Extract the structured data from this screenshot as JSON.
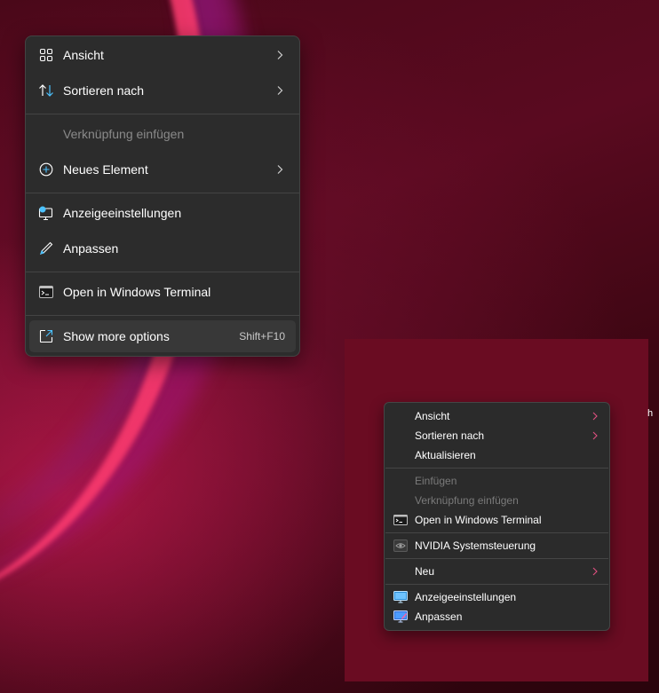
{
  "modern_menu": {
    "items": [
      {
        "label": "Ansicht",
        "icon": "view-grid-icon",
        "submenu": true
      },
      {
        "label": "Sortieren nach",
        "icon": "sort-icon",
        "submenu": true
      },
      {
        "label": "Verknüpfung einfügen",
        "disabled": true
      },
      {
        "label": "Neues Element",
        "icon": "new-item-icon",
        "submenu": true
      },
      {
        "label": "Anzeigeeinstellungen",
        "icon": "display-settings-icon"
      },
      {
        "label": "Anpassen",
        "icon": "personalize-pen-icon"
      },
      {
        "label": "Open in Windows Terminal",
        "icon": "terminal-icon"
      },
      {
        "label": "Show more options",
        "icon": "show-more-options-icon",
        "shortcut": "Shift+F10"
      }
    ]
  },
  "classic_menu": {
    "items": [
      {
        "label": "Ansicht",
        "submenu": true
      },
      {
        "label": "Sortieren nach",
        "submenu": true
      },
      {
        "label": "Aktualisieren"
      },
      {
        "label": "Einfügen",
        "disabled": true
      },
      {
        "label": "Verknüpfung einfügen",
        "disabled": true
      },
      {
        "label": "Open in Windows Terminal",
        "icon": "terminal-icon"
      },
      {
        "label": "NVIDIA Systemsteuerung",
        "icon": "nvidia-icon"
      },
      {
        "label": "Neu",
        "submenu": true
      },
      {
        "label": "Anzeigeeinstellungen",
        "icon": "display-settings-icon"
      },
      {
        "label": "Anpassen",
        "icon": "personalize-icon"
      }
    ]
  },
  "stray_text": "h",
  "colors": {
    "accent": "#4cc2ff",
    "menu_bg": "#2c2c2c",
    "chevron_classic": "#e05080"
  }
}
